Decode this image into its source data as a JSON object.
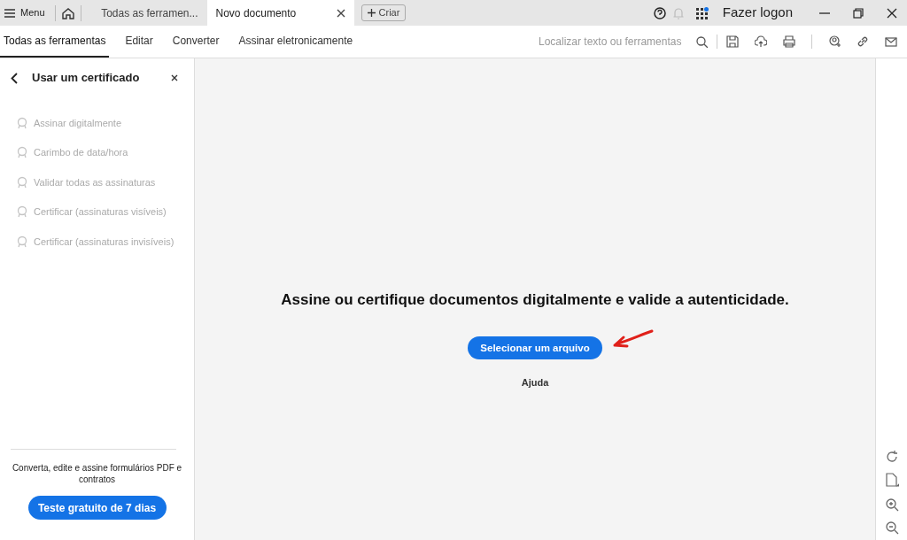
{
  "title_bar": {
    "menu": "Menu",
    "tabs": [
      {
        "label": "Todas as ferramen...",
        "selected": false,
        "closable": false
      },
      {
        "label": "Novo documento",
        "selected": true,
        "closable": true
      }
    ],
    "create": "Criar",
    "sign_in": "Fazer logon"
  },
  "toolbar": {
    "tabs": [
      {
        "label": "Todas as ferramentas",
        "selected": true
      },
      {
        "label": "Editar",
        "selected": false
      },
      {
        "label": "Converter",
        "selected": false
      },
      {
        "label": "Assinar eletronicamente",
        "selected": false
      }
    ],
    "search": {
      "placeholder": "Localizar texto ou ferramentas"
    }
  },
  "sidebar": {
    "title": "Usar um certificado",
    "items": [
      {
        "label": "Assinar digitalmente",
        "disabled": true
      },
      {
        "label": "Carimbo de data/hora",
        "disabled": true
      },
      {
        "label": "Validar todas as assinaturas",
        "disabled": true
      },
      {
        "label": "Certificar (assinaturas visíveis)",
        "disabled": true
      },
      {
        "label": "Certificar (assinaturas invisíveis)",
        "disabled": true
      }
    ],
    "promo": "Converta, edite e assine formulários PDF e contratos",
    "trial_button": "Teste gratuito de 7 dias"
  },
  "main": {
    "heading": "Assine ou certifique documentos digitalmente e valide a autenticidade.",
    "button": "Selecionar um arquivo",
    "help": "Ajuda"
  }
}
